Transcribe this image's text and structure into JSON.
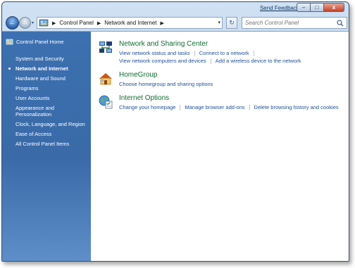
{
  "titlebar": {
    "feedback_label": "Send Feedback",
    "minimize_glyph": "–",
    "maximize_glyph": "□",
    "close_glyph": "x"
  },
  "nav": {
    "back_glyph": "←",
    "forward_glyph": "→",
    "dropdown_glyph": "▾"
  },
  "address": {
    "separator": "▶",
    "crumbs": [
      "Control Panel",
      "Network and Internet"
    ],
    "dropdown_glyph": "▾"
  },
  "refresh_glyph": "↻",
  "search": {
    "placeholder": "Search Control Panel",
    "value": ""
  },
  "sidebar": {
    "home_label": "Control Panel Home",
    "items": [
      {
        "label": "System and Security",
        "active": false
      },
      {
        "label": "Network and Internet",
        "active": true
      },
      {
        "label": "Hardware and Sound",
        "active": false
      },
      {
        "label": "Programs",
        "active": false
      },
      {
        "label": "User Accounts",
        "active": false
      },
      {
        "label": "Appearance and Personalization",
        "active": false
      },
      {
        "label": "Clock, Language, and Region",
        "active": false
      },
      {
        "label": "Ease of Access",
        "active": false
      },
      {
        "label": "All Control Panel Items",
        "active": false
      }
    ]
  },
  "categories": [
    {
      "title": "Network and Sharing Center",
      "icon": "network-sharing-icon",
      "rows": [
        [
          "View network status and tasks",
          "Connect to a network"
        ],
        [
          "View network computers and devices",
          "Add a wireless device to the network"
        ]
      ]
    },
    {
      "title": "HomeGroup",
      "icon": "homegroup-icon",
      "rows": [
        [
          "Choose homegroup and sharing options"
        ]
      ]
    },
    {
      "title": "Internet Options",
      "icon": "internet-options-icon",
      "rows": [
        [
          "Change your homepage",
          "Manage browser add-ons",
          "Delete browsing history and cookies"
        ]
      ]
    }
  ],
  "colors": {
    "sidebar": "#3a6aa8",
    "category_title": "#0c6e2e",
    "link": "#1d4f9c"
  }
}
